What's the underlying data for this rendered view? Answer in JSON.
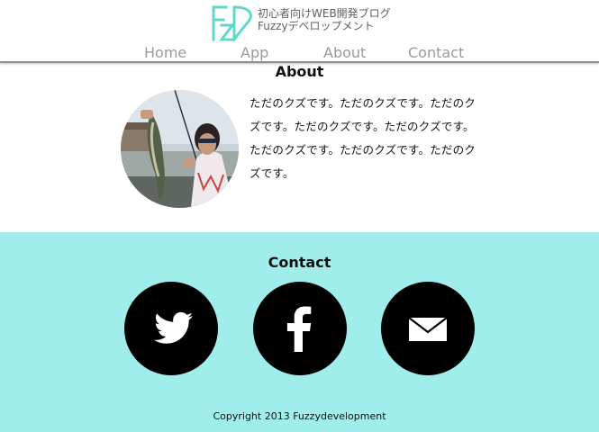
{
  "header": {
    "logo_mark": "FZD",
    "tagline_line1": "初心者向けWEB開発ブログ",
    "tagline_line2": "Fuzzyデベロップメント",
    "brand_color": "#5fd9c7"
  },
  "nav": {
    "items": [
      {
        "label": "Home"
      },
      {
        "label": "App"
      },
      {
        "label": "About"
      },
      {
        "label": "Contact"
      }
    ]
  },
  "about": {
    "title": "About",
    "avatar_icon": "profile-photo-fishing",
    "text": "ただのクズです。ただのクズです。ただのクズです。ただのクズです。ただのクズです。ただのクズです。ただのクズです。ただのクズです。"
  },
  "contact": {
    "title": "Contact",
    "background": "#a0eeec",
    "links": [
      {
        "icon": "twitter-icon"
      },
      {
        "icon": "facebook-icon"
      },
      {
        "icon": "mail-icon"
      }
    ]
  },
  "footer": {
    "copyright": "Copyright 2013 Fuzzydevelopment"
  }
}
